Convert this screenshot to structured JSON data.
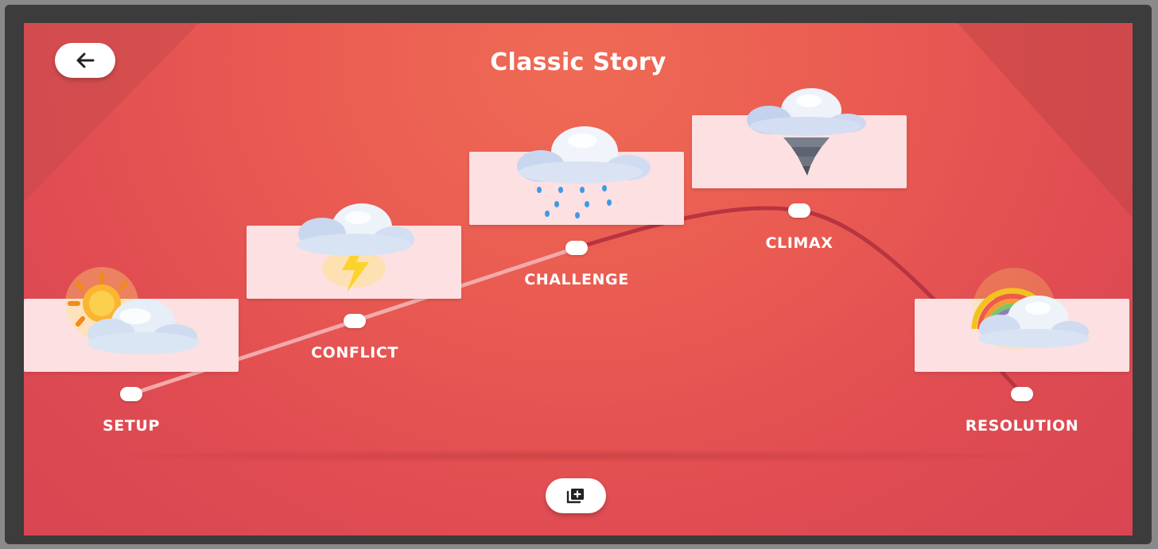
{
  "header": {
    "title": "Classic Story"
  },
  "colors": {
    "background": "#e85553",
    "card": "#fde0e2",
    "path_done": "#f2a6a6",
    "path_todo": "#b83440"
  },
  "toolbar": {
    "back_icon": "arrow-left-icon",
    "add_icon": "add-to-queue-icon"
  },
  "stages": [
    {
      "label": "SETUP",
      "icon": "sun-cloud-icon"
    },
    {
      "label": "CONFLICT",
      "icon": "lightning-cloud-icon"
    },
    {
      "label": "CHALLENGE",
      "icon": "rain-cloud-icon"
    },
    {
      "label": "CLIMAX",
      "icon": "tornado-cloud-icon"
    },
    {
      "label": "RESOLUTION",
      "icon": "rainbow-cloud-icon"
    }
  ]
}
